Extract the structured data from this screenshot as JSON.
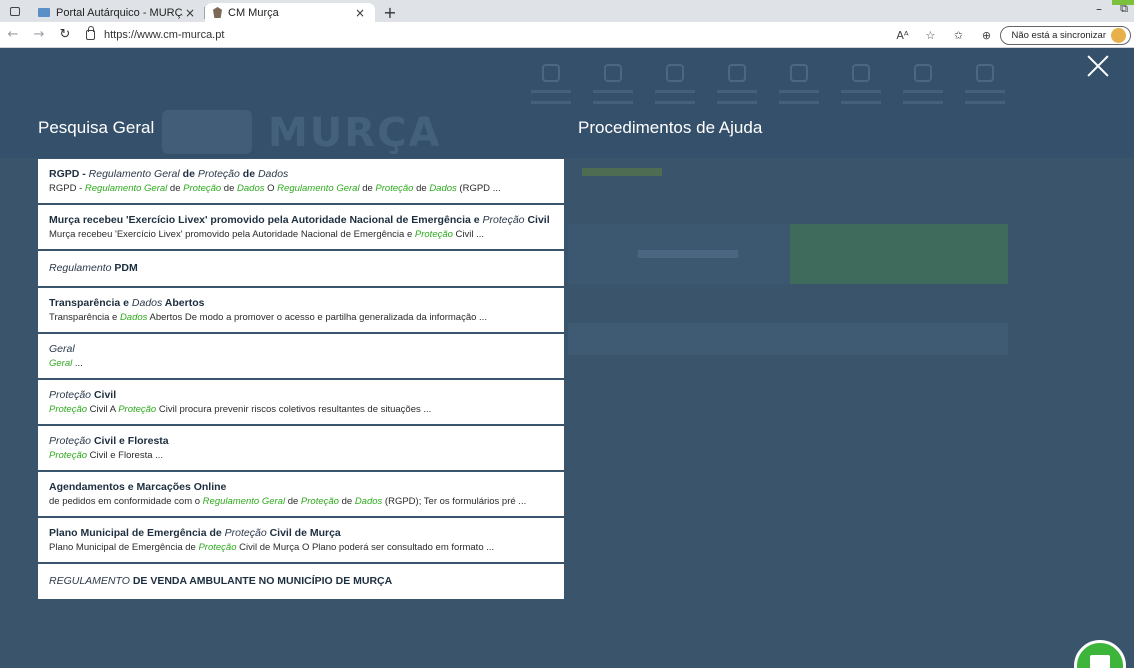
{
  "browser": {
    "tabs": [
      {
        "title": "Portal Autárquico - MURÇA",
        "close": "×",
        "active": false
      },
      {
        "title": "CM Murça",
        "close": "×",
        "active": true
      }
    ],
    "new_tab": "+",
    "url": "https://www.cm-murca.pt",
    "sync_label": "Não está a sincronizar",
    "window_min": "–",
    "window_restore": "⧉"
  },
  "overlay": {
    "search_title": "Pesquisa Geral",
    "help_title": "Procedimentos de Ajuda"
  },
  "results": [
    {
      "title": [
        [
          "RGPD - ",
          ""
        ],
        [
          "Regulamento Geral",
          "hl"
        ],
        [
          " de ",
          ""
        ],
        [
          "Proteção",
          "hl"
        ],
        [
          " de ",
          ""
        ],
        [
          "Dados",
          "hl"
        ]
      ],
      "snippet": [
        [
          "RGPD - ",
          ""
        ],
        [
          "Regulamento Geral",
          "hl"
        ],
        [
          " de ",
          ""
        ],
        [
          "Proteção",
          "hl"
        ],
        [
          " de ",
          ""
        ],
        [
          "Dados",
          "hl"
        ],
        [
          " O ",
          ""
        ],
        [
          "Regulamento Geral",
          "hl"
        ],
        [
          " de ",
          ""
        ],
        [
          "Proteção",
          "hl"
        ],
        [
          " de ",
          ""
        ],
        [
          "Dados",
          "hl"
        ],
        [
          " (RGPD ...",
          ""
        ]
      ]
    },
    {
      "title": [
        [
          "Murça recebeu 'Exercício Livex' promovido pela Autoridade Nacional de Emergência e ",
          ""
        ],
        [
          "Proteção",
          "hl"
        ],
        [
          " Civil",
          ""
        ]
      ],
      "snippet": [
        [
          "Murça recebeu 'Exercício Livex' promovido pela Autoridade Nacional de Emergência e ",
          ""
        ],
        [
          "Proteção",
          "hl"
        ],
        [
          " Civil ...",
          ""
        ]
      ]
    },
    {
      "title": [
        [
          "Regulamento",
          "hl"
        ],
        [
          " PDM",
          ""
        ]
      ],
      "snippet": []
    },
    {
      "title": [
        [
          "Transparência e ",
          ""
        ],
        [
          "Dados",
          "hl"
        ],
        [
          " Abertos",
          ""
        ]
      ],
      "snippet": [
        [
          "Transparência e ",
          ""
        ],
        [
          "Dados",
          "hl"
        ],
        [
          " Abertos De modo a promover o acesso e partilha generalizada da informação ...",
          ""
        ]
      ]
    },
    {
      "title": [
        [
          "Geral",
          "hl"
        ]
      ],
      "snippet": [
        [
          "Geral",
          "hl"
        ],
        [
          " ...",
          ""
        ]
      ]
    },
    {
      "title": [
        [
          "Proteção",
          "hl"
        ],
        [
          " Civil",
          ""
        ]
      ],
      "snippet": [
        [
          "Proteção",
          "hl"
        ],
        [
          " Civil A ",
          ""
        ],
        [
          "Proteção",
          "hl"
        ],
        [
          " Civil procura prevenir riscos coletivos resultantes de situações ...",
          ""
        ]
      ]
    },
    {
      "title": [
        [
          "Proteção",
          "hl"
        ],
        [
          " Civil e Floresta",
          ""
        ]
      ],
      "snippet": [
        [
          "Proteção",
          "hl"
        ],
        [
          " Civil e Floresta ...",
          ""
        ]
      ]
    },
    {
      "title": [
        [
          "Agendamentos e Marcações Online",
          ""
        ]
      ],
      "snippet": [
        [
          "de pedidos em conformidade com o ",
          ""
        ],
        [
          "Regulamento Geral",
          "hl"
        ],
        [
          " de ",
          ""
        ],
        [
          "Proteção",
          "hl"
        ],
        [
          " de ",
          ""
        ],
        [
          "Dados",
          "hl"
        ],
        [
          " (RGPD); Ter os formulários pré ...",
          ""
        ]
      ],
      "wrap": true
    },
    {
      "title": [
        [
          "Plano Municipal de Emergência de ",
          ""
        ],
        [
          "Proteção",
          "hl"
        ],
        [
          " Civil de Murça",
          ""
        ]
      ],
      "snippet": [
        [
          "Plano Municipal de Emergência de ",
          ""
        ],
        [
          "Proteção",
          "hl"
        ],
        [
          " Civil de Murça O Plano poderá ser consultado em formato ...",
          ""
        ]
      ]
    },
    {
      "title": [
        [
          "REGULAMENTO",
          "hl"
        ],
        [
          " DE VENDA AMBULANTE NO MUNICÍPIO DE MURÇA",
          ""
        ]
      ],
      "snippet": []
    }
  ],
  "colors": {
    "overlay": "#3a546b",
    "highlight_snippet": "#2eaa1e",
    "title_text": "#1d2e3f",
    "chat_button": "#3db53a"
  },
  "icons": [
    "tab-actions-icon",
    "portal-favicon-icon",
    "cm-murca-favicon-icon",
    "back-arrow-icon",
    "forward-arrow-icon",
    "refresh-icon",
    "lock-icon",
    "read-aloud-icon",
    "add-favorite-icon",
    "favorites-icon",
    "collections-icon",
    "profile-avatar-icon",
    "close-overlay-icon",
    "chat-icon"
  ]
}
